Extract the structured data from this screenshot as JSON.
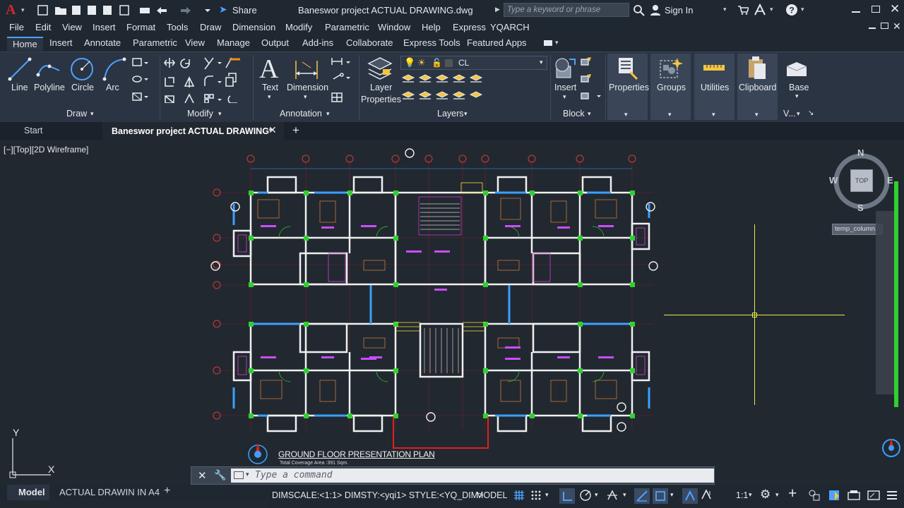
{
  "title_bar": {
    "app_logo": "A",
    "share_label": "Share",
    "file_title": "Baneswor project ACTUAL DRAWING.dwg",
    "search_placeholder": "Type a keyword or phrase",
    "sign_in": "Sign In"
  },
  "menu": [
    "File",
    "Edit",
    "View",
    "Insert",
    "Format",
    "Tools",
    "Draw",
    "Dimension",
    "Modify",
    "Parametric",
    "Window",
    "Help",
    "Express",
    "YQARCH"
  ],
  "ribbon_tabs": [
    "Home",
    "Insert",
    "Annotate",
    "Parametric",
    "View",
    "Manage",
    "Output",
    "Add-ins",
    "Collaborate",
    "Express Tools",
    "Featured Apps"
  ],
  "ribbon": {
    "draw": {
      "title": "Draw",
      "line": "Line",
      "polyline": "Polyline",
      "circle": "Circle",
      "arc": "Arc"
    },
    "modify": {
      "title": "Modify"
    },
    "annotation": {
      "title": "Annotation",
      "text": "Text",
      "dimension": "Dimension"
    },
    "layers": {
      "title": "Layers",
      "layer_properties_1": "Layer",
      "layer_properties_2": "Properties",
      "current_layer": "CL"
    },
    "block": {
      "title": "Block",
      "insert": "Insert"
    },
    "properties": "Properties",
    "groups": "Groups",
    "utilities": "Utilities",
    "clipboard": "Clipboard",
    "base": "Base",
    "view_short": "V..."
  },
  "doc_tabs": {
    "start": "Start",
    "active": "Baneswor project ACTUAL DRAWING*"
  },
  "viewport": {
    "label": "[−][Top][2D Wireframe]",
    "viewcube": {
      "n": "N",
      "s": "S",
      "e": "E",
      "w": "W",
      "top": "TOP"
    },
    "tooltip": "temp_column",
    "plan_title": "GROUND FLOOR PRESENTATION PLAN",
    "plan_subtitle": "Total Coverage Area :391 Sqm.",
    "ucs_y": "Y",
    "ucs_x": "X"
  },
  "command_line": {
    "placeholder": "Type a command"
  },
  "model_tabs": {
    "model": "Model",
    "layout": "ACTUAL DRAWIN IN A4"
  },
  "status": {
    "dim_info": "DIMSCALE:<1:1> DIMSTY:<yqi1> STYLE:<YQ_DIM>",
    "space": "MODEL",
    "scale": "1:1"
  },
  "colors": {
    "accent": "#4ea1ff",
    "background": "#212830",
    "ribbon": "#2b3442"
  }
}
